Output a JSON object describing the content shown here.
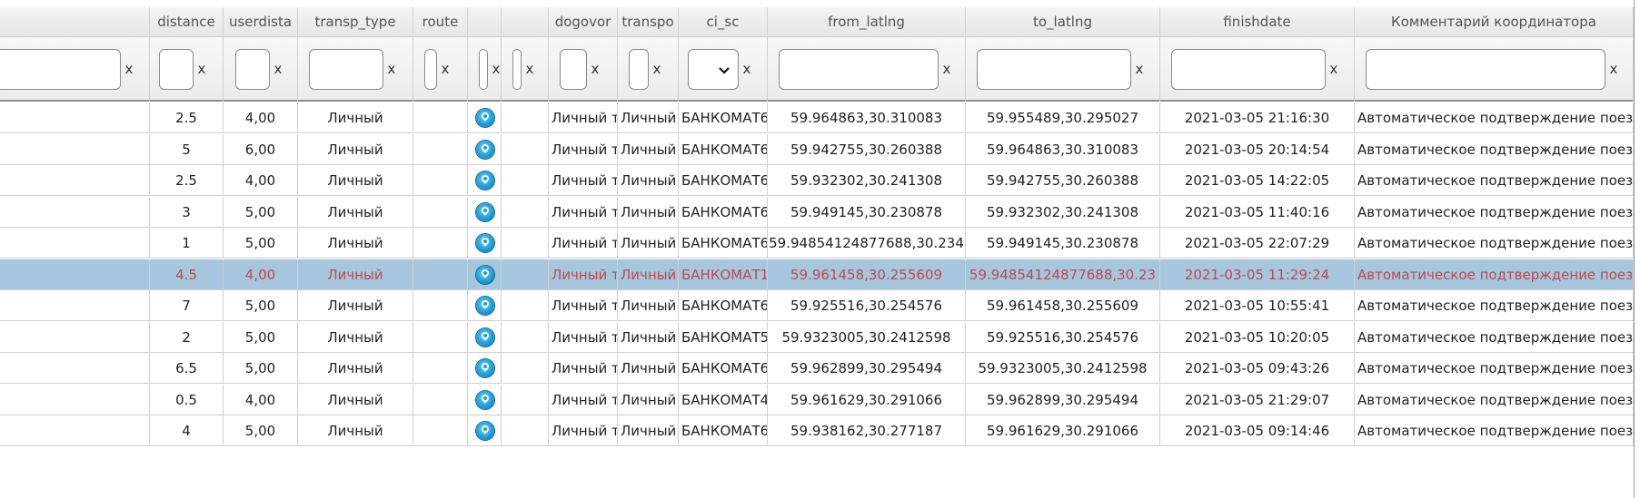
{
  "columns": [
    {
      "key": "c0",
      "label": ""
    },
    {
      "key": "distance",
      "label": "distance"
    },
    {
      "key": "userdist",
      "label": "userdista"
    },
    {
      "key": "transp_type",
      "label": "transp_type"
    },
    {
      "key": "route",
      "label": "route"
    },
    {
      "key": "pin",
      "label": ""
    },
    {
      "key": "blank",
      "label": ""
    },
    {
      "key": "dogovor",
      "label": "dogovor"
    },
    {
      "key": "transp",
      "label": "transpo"
    },
    {
      "key": "ci_sc",
      "label": "ci_sc"
    },
    {
      "key": "from_latlng",
      "label": "from_latlng"
    },
    {
      "key": "to_latlng",
      "label": "to_latlng"
    },
    {
      "key": "finishdate",
      "label": "finishdate"
    },
    {
      "key": "comment",
      "label": "Комментарий координатора"
    }
  ],
  "filter_clear_label": "x",
  "icons": {
    "pin": "map-marker-icon",
    "chevron": "chevron-down-icon"
  },
  "colors": {
    "selected_row": "#a6c6de",
    "selected_text": "#c04a4a"
  },
  "rows": [
    {
      "distance": "2.5",
      "userdist": "4,00",
      "transp_type": "Личный",
      "dogovor": "Личный т",
      "transp": "Личный",
      "ci_sc": "БАНКОМАТ6",
      "from": "59.964863,30.310083",
      "to": "59.955489,30.295027",
      "finishdate": "2021-03-05 21:16:30",
      "comment": "Автоматическое подтверждение поезд"
    },
    {
      "distance": "5",
      "userdist": "6,00",
      "transp_type": "Личный",
      "dogovor": "Личный т",
      "transp": "Личный",
      "ci_sc": "БАНКОМАТ6",
      "from": "59.942755,30.260388",
      "to": "59.964863,30.310083",
      "finishdate": "2021-03-05 20:14:54",
      "comment": "Автоматическое подтверждение поезд"
    },
    {
      "distance": "2.5",
      "userdist": "4,00",
      "transp_type": "Личный",
      "dogovor": "Личный т",
      "transp": "Личный",
      "ci_sc": "БАНКОМАТ6",
      "from": "59.932302,30.241308",
      "to": "59.942755,30.260388",
      "finishdate": "2021-03-05 14:22:05",
      "comment": "Автоматическое подтверждение поезд"
    },
    {
      "distance": "3",
      "userdist": "5,00",
      "transp_type": "Личный",
      "dogovor": "Личный т",
      "transp": "Личный",
      "ci_sc": "БАНКОМАТ6",
      "from": "59.949145,30.230878",
      "to": "59.932302,30.241308",
      "finishdate": "2021-03-05 11:40:16",
      "comment": "Автоматическое подтверждение поезд"
    },
    {
      "distance": "1",
      "userdist": "5,00",
      "transp_type": "Личный",
      "dogovor": "Личный т",
      "transp": "Личный",
      "ci_sc": "БАНКОМАТ6",
      "from": "59.94854124877688,30.234",
      "to": "59.949145,30.230878",
      "finishdate": "2021-03-05 22:07:29",
      "comment": "Автоматическое подтверждение поезд"
    },
    {
      "distance": "4.5",
      "userdist": "4,00",
      "transp_type": "Личный",
      "dogovor": "Личный т",
      "transp": "Личный",
      "ci_sc": "БАНКОМАТ1",
      "from": "59.961458,30.255609",
      "to": "59.94854124877688,30.23",
      "finishdate": "2021-03-05 11:29:24",
      "comment": "Автоматическое подтверждение поезд",
      "selected": true
    },
    {
      "distance": "7",
      "userdist": "5,00",
      "transp_type": "Личный",
      "dogovor": "Личный т",
      "transp": "Личный",
      "ci_sc": "БАНКОМАТ6",
      "from": "59.925516,30.254576",
      "to": "59.961458,30.255609",
      "finishdate": "2021-03-05 10:55:41",
      "comment": "Автоматическое подтверждение поезд"
    },
    {
      "distance": "2",
      "userdist": "5,00",
      "transp_type": "Личный",
      "dogovor": "Личный т",
      "transp": "Личный",
      "ci_sc": "БАНКОМАТ5",
      "from": "59.9323005,30.2412598",
      "to": "59.925516,30.254576",
      "finishdate": "2021-03-05 10:20:05",
      "comment": "Автоматическое подтверждение поезд"
    },
    {
      "distance": "6.5",
      "userdist": "5,00",
      "transp_type": "Личный",
      "dogovor": "Личный т",
      "transp": "Личный",
      "ci_sc": "БАНКОМАТ6",
      "from": "59.962899,30.295494",
      "to": "59.9323005,30.2412598",
      "finishdate": "2021-03-05 09:43:26",
      "comment": "Автоматическое подтверждение поезд"
    },
    {
      "distance": "0.5",
      "userdist": "4,00",
      "transp_type": "Личный",
      "dogovor": "Личный т",
      "transp": "Личный",
      "ci_sc": "БАНКОМАТ4",
      "from": "59.961629,30.291066",
      "to": "59.962899,30.295494",
      "finishdate": "2021-03-05 21:29:07",
      "comment": "Автоматическое подтверждение поезд"
    },
    {
      "distance": "4",
      "userdist": "5,00",
      "transp_type": "Личный",
      "dogovor": "Личный т",
      "transp": "Личный",
      "ci_sc": "БАНКОМАТ6",
      "from": "59.938162,30.277187",
      "to": "59.961629,30.291066",
      "finishdate": "2021-03-05 09:14:46",
      "comment": "Автоматическое подтверждение поезд"
    }
  ]
}
